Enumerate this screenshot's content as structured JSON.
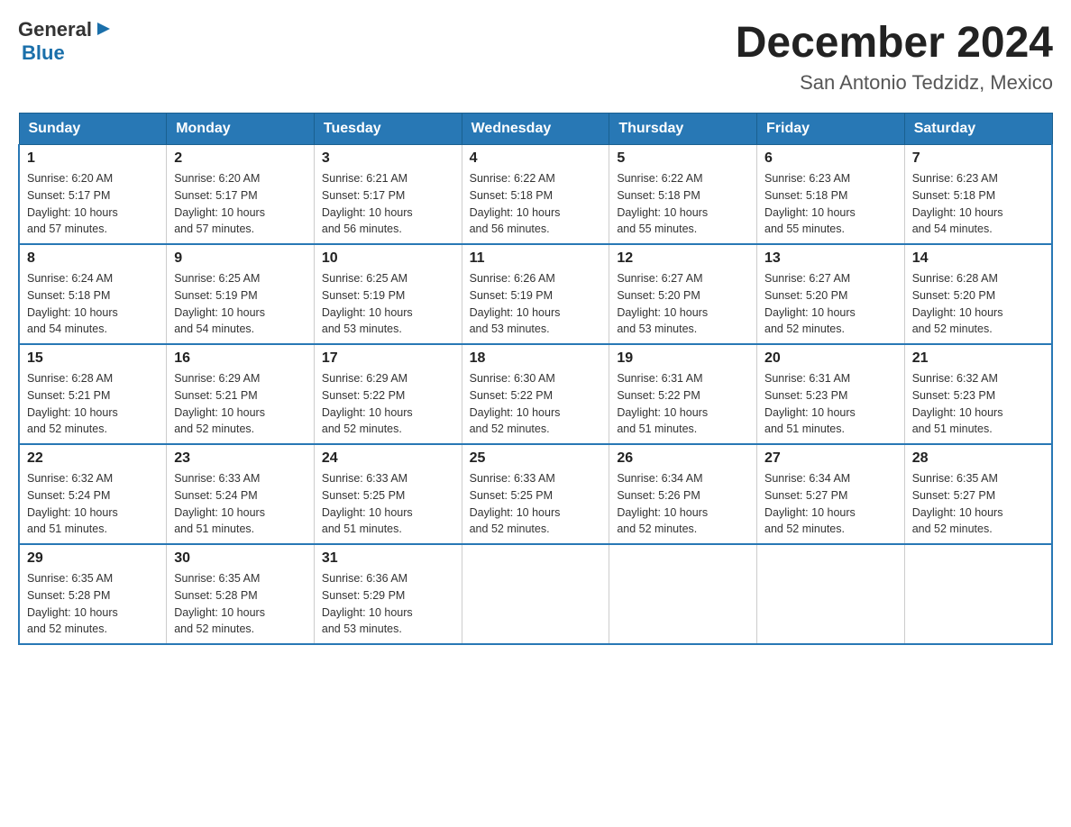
{
  "header": {
    "logo_general": "General",
    "logo_blue": "Blue",
    "title": "December 2024",
    "subtitle": "San Antonio Tedzidz, Mexico"
  },
  "days_of_week": [
    "Sunday",
    "Monday",
    "Tuesday",
    "Wednesday",
    "Thursday",
    "Friday",
    "Saturday"
  ],
  "weeks": [
    [
      {
        "day": "1",
        "sunrise": "6:20 AM",
        "sunset": "5:17 PM",
        "daylight": "10 hours and 57 minutes."
      },
      {
        "day": "2",
        "sunrise": "6:20 AM",
        "sunset": "5:17 PM",
        "daylight": "10 hours and 57 minutes."
      },
      {
        "day": "3",
        "sunrise": "6:21 AM",
        "sunset": "5:17 PM",
        "daylight": "10 hours and 56 minutes."
      },
      {
        "day": "4",
        "sunrise": "6:22 AM",
        "sunset": "5:18 PM",
        "daylight": "10 hours and 56 minutes."
      },
      {
        "day": "5",
        "sunrise": "6:22 AM",
        "sunset": "5:18 PM",
        "daylight": "10 hours and 55 minutes."
      },
      {
        "day": "6",
        "sunrise": "6:23 AM",
        "sunset": "5:18 PM",
        "daylight": "10 hours and 55 minutes."
      },
      {
        "day": "7",
        "sunrise": "6:23 AM",
        "sunset": "5:18 PM",
        "daylight": "10 hours and 54 minutes."
      }
    ],
    [
      {
        "day": "8",
        "sunrise": "6:24 AM",
        "sunset": "5:18 PM",
        "daylight": "10 hours and 54 minutes."
      },
      {
        "day": "9",
        "sunrise": "6:25 AM",
        "sunset": "5:19 PM",
        "daylight": "10 hours and 54 minutes."
      },
      {
        "day": "10",
        "sunrise": "6:25 AM",
        "sunset": "5:19 PM",
        "daylight": "10 hours and 53 minutes."
      },
      {
        "day": "11",
        "sunrise": "6:26 AM",
        "sunset": "5:19 PM",
        "daylight": "10 hours and 53 minutes."
      },
      {
        "day": "12",
        "sunrise": "6:27 AM",
        "sunset": "5:20 PM",
        "daylight": "10 hours and 53 minutes."
      },
      {
        "day": "13",
        "sunrise": "6:27 AM",
        "sunset": "5:20 PM",
        "daylight": "10 hours and 52 minutes."
      },
      {
        "day": "14",
        "sunrise": "6:28 AM",
        "sunset": "5:20 PM",
        "daylight": "10 hours and 52 minutes."
      }
    ],
    [
      {
        "day": "15",
        "sunrise": "6:28 AM",
        "sunset": "5:21 PM",
        "daylight": "10 hours and 52 minutes."
      },
      {
        "day": "16",
        "sunrise": "6:29 AM",
        "sunset": "5:21 PM",
        "daylight": "10 hours and 52 minutes."
      },
      {
        "day": "17",
        "sunrise": "6:29 AM",
        "sunset": "5:22 PM",
        "daylight": "10 hours and 52 minutes."
      },
      {
        "day": "18",
        "sunrise": "6:30 AM",
        "sunset": "5:22 PM",
        "daylight": "10 hours and 52 minutes."
      },
      {
        "day": "19",
        "sunrise": "6:31 AM",
        "sunset": "5:22 PM",
        "daylight": "10 hours and 51 minutes."
      },
      {
        "day": "20",
        "sunrise": "6:31 AM",
        "sunset": "5:23 PM",
        "daylight": "10 hours and 51 minutes."
      },
      {
        "day": "21",
        "sunrise": "6:32 AM",
        "sunset": "5:23 PM",
        "daylight": "10 hours and 51 minutes."
      }
    ],
    [
      {
        "day": "22",
        "sunrise": "6:32 AM",
        "sunset": "5:24 PM",
        "daylight": "10 hours and 51 minutes."
      },
      {
        "day": "23",
        "sunrise": "6:33 AM",
        "sunset": "5:24 PM",
        "daylight": "10 hours and 51 minutes."
      },
      {
        "day": "24",
        "sunrise": "6:33 AM",
        "sunset": "5:25 PM",
        "daylight": "10 hours and 51 minutes."
      },
      {
        "day": "25",
        "sunrise": "6:33 AM",
        "sunset": "5:25 PM",
        "daylight": "10 hours and 52 minutes."
      },
      {
        "day": "26",
        "sunrise": "6:34 AM",
        "sunset": "5:26 PM",
        "daylight": "10 hours and 52 minutes."
      },
      {
        "day": "27",
        "sunrise": "6:34 AM",
        "sunset": "5:27 PM",
        "daylight": "10 hours and 52 minutes."
      },
      {
        "day": "28",
        "sunrise": "6:35 AM",
        "sunset": "5:27 PM",
        "daylight": "10 hours and 52 minutes."
      }
    ],
    [
      {
        "day": "29",
        "sunrise": "6:35 AM",
        "sunset": "5:28 PM",
        "daylight": "10 hours and 52 minutes."
      },
      {
        "day": "30",
        "sunrise": "6:35 AM",
        "sunset": "5:28 PM",
        "daylight": "10 hours and 52 minutes."
      },
      {
        "day": "31",
        "sunrise": "6:36 AM",
        "sunset": "5:29 PM",
        "daylight": "10 hours and 53 minutes."
      },
      null,
      null,
      null,
      null
    ]
  ],
  "labels": {
    "sunrise_prefix": "Sunrise: ",
    "sunset_prefix": "Sunset: ",
    "daylight_prefix": "Daylight: "
  }
}
